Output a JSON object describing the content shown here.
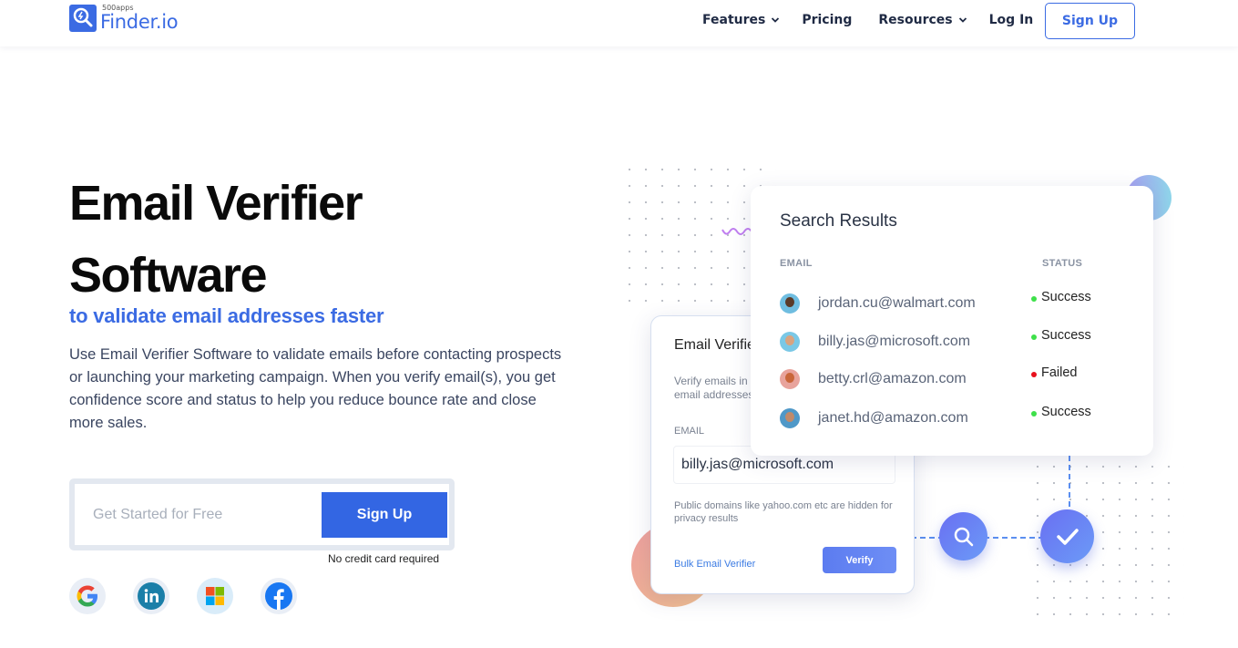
{
  "header": {
    "logo_sub": "500apps",
    "logo_main": "Finder.io",
    "nav": [
      {
        "label": "Features",
        "has_dropdown": true
      },
      {
        "label": "Pricing",
        "has_dropdown": false
      },
      {
        "label": "Resources",
        "has_dropdown": true
      },
      {
        "label": "Log In",
        "has_dropdown": false
      }
    ],
    "signup_label": "Sign Up"
  },
  "hero": {
    "title_line1": "Email Verifier",
    "title_line2": "Software",
    "subtitle": "to validate email addresses faster",
    "description": "Use Email Verifier Software to validate emails before contacting prospects or launching your marketing campaign. When you verify email(s), you get confidence score and status to help you reduce bounce rate and close more sales.",
    "input_placeholder": "Get Started for Free",
    "signup_label": "Sign Up",
    "no_cc": "No credit card required",
    "socials": [
      "google-icon",
      "linkedin-icon",
      "microsoft-icon",
      "facebook-icon"
    ]
  },
  "illustration": {
    "search_results": {
      "title": "Search Results",
      "col_email": "EMAIL",
      "col_status": "STATUS",
      "rows": [
        {
          "email": "jordan.cu@walmart.com",
          "status": "Success",
          "status_color": "#3ee04a"
        },
        {
          "email": "billy.jas@microsoft.com",
          "status": "Success",
          "status_color": "#3ee04a"
        },
        {
          "email": "betty.crl@amazon.com",
          "status": "Failed",
          "status_color": "#e8101c"
        },
        {
          "email": "janet.hd@amazon.com",
          "status": "Success",
          "status_color": "#3ee04a"
        }
      ]
    },
    "verifier": {
      "title": "Email Verifier",
      "desc_line1": "Verify emails in",
      "desc_line2": "email addresses",
      "email_label": "EMAIL",
      "email_value": "billy.jas@microsoft.com",
      "note": "Public domains like yahoo.com etc are hidden for privacy results",
      "bulk_link": "Bulk Email Verifier",
      "verify_label": "Verify"
    }
  },
  "colors": {
    "brand": "#3b6be3",
    "success": "#3ee04a",
    "failed": "#e8101c"
  }
}
